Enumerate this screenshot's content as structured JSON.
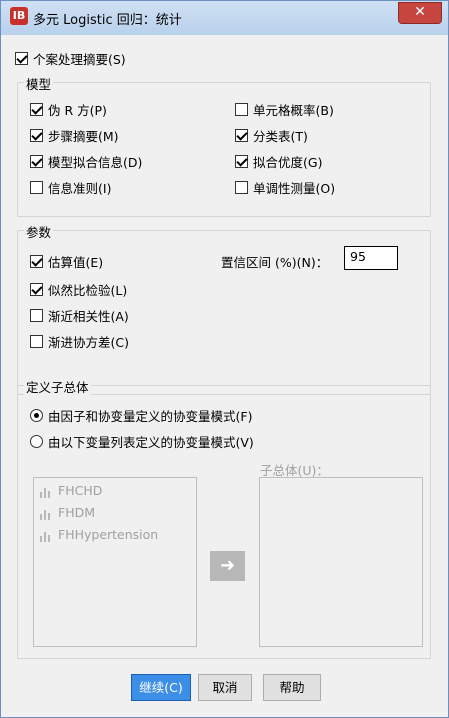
{
  "window": {
    "title": "多元 Logistic 回归：统计",
    "close_symbol": "✕",
    "app_icon_glyph": "IB"
  },
  "case_summary": {
    "label": "个案处理摘要(S)",
    "checked": true
  },
  "model": {
    "legend": "模型",
    "left": [
      {
        "label": "伪 R 方(P)",
        "checked": true
      },
      {
        "label": "步骤摘要(M)",
        "checked": true
      },
      {
        "label": "模型拟合信息(D)",
        "checked": true
      },
      {
        "label": "信息准则(I)",
        "checked": false
      }
    ],
    "right": [
      {
        "label": "单元格概率(B)",
        "checked": false
      },
      {
        "label": "分类表(T)",
        "checked": true
      },
      {
        "label": "拟合优度(G)",
        "checked": true
      },
      {
        "label": "单调性测量(O)",
        "checked": false
      }
    ]
  },
  "params": {
    "legend": "参数",
    "items": [
      {
        "label": "估算值(E)",
        "checked": true
      },
      {
        "label": "似然比检验(L)",
        "checked": true
      },
      {
        "label": "渐近相关性(A)",
        "checked": false
      },
      {
        "label": "渐进协方差(C)",
        "checked": false
      }
    ],
    "ci_label": "置信区间 (%)(N)：",
    "ci_value": "95"
  },
  "subpop": {
    "legend": "定义子总体",
    "radio_1": {
      "label": "由因子和协变量定义的协变量模式(F)",
      "selected": true
    },
    "radio_2": {
      "label": "由以下变量列表定义的协变量模式(V)",
      "selected": false
    },
    "subpop_label": "子总体(U)：",
    "variables": [
      "FHCHD",
      "FHDM",
      "FHHypertension"
    ],
    "arrow_icon": "➜"
  },
  "buttons": {
    "continue": "继续(C)",
    "cancel": "取消",
    "help": "帮助"
  }
}
